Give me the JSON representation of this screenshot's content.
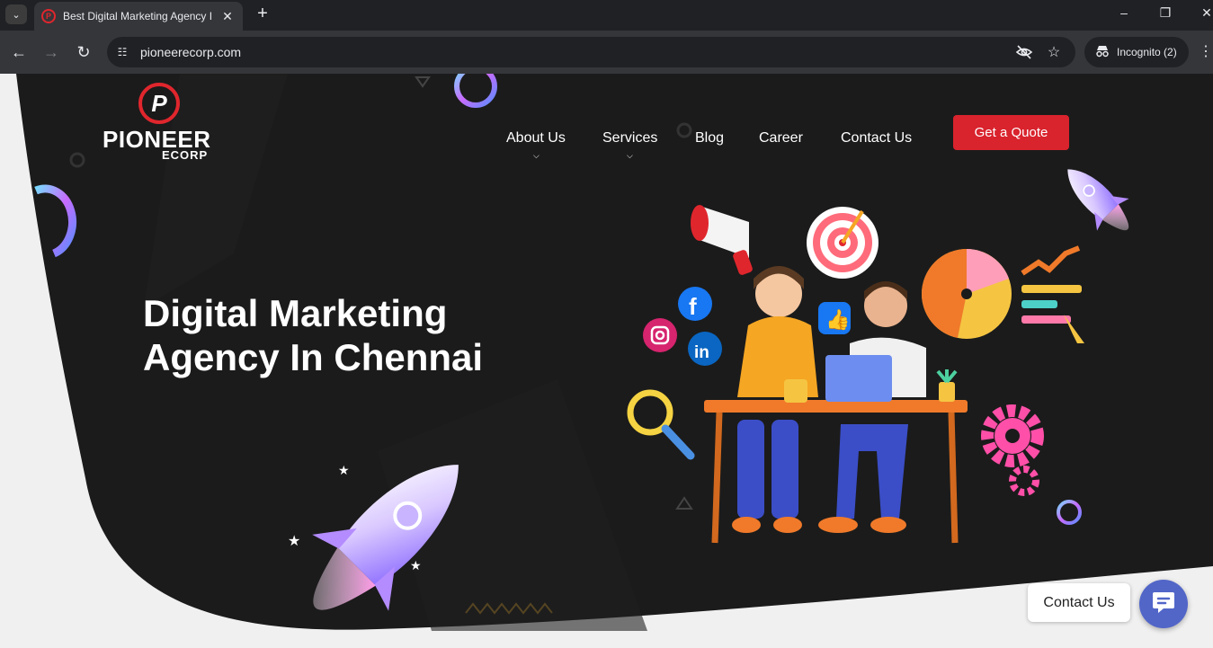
{
  "browser": {
    "tab_title": "Best Digital Marketing Agency In Chennai",
    "url": "pioneerecorp.com",
    "incognito_label": "Incognito (2)",
    "icons": [
      "tab-search-icon",
      "favicon",
      "close-icon",
      "new-tab-icon",
      "minimize-icon",
      "restore-icon",
      "window-close-icon",
      "back-icon",
      "forward-icon",
      "reload-icon",
      "site-info-icon",
      "eye-off-icon",
      "star-icon",
      "incognito-icon",
      "menu-icon"
    ]
  },
  "logo": {
    "mark": "P",
    "name": "PIONEER",
    "sub": "ECORP"
  },
  "nav": {
    "items": [
      {
        "label": "About Us",
        "has_dropdown": true
      },
      {
        "label": "Services",
        "has_dropdown": true
      },
      {
        "label": "Blog",
        "has_dropdown": false
      },
      {
        "label": "Career",
        "has_dropdown": false
      },
      {
        "label": "Contact Us",
        "has_dropdown": false
      }
    ],
    "cta": "Get a Quote"
  },
  "hero": {
    "headline_line1": "Digital Marketing",
    "headline_line2": "Agency In Chennai"
  },
  "chat_widget": {
    "label": "Contact Us"
  },
  "colors": {
    "brand_red": "#d9232d",
    "hero_bg": "#1b1b1b",
    "page_bg": "#f0f0f0",
    "chat_blue": "#5266c8"
  }
}
